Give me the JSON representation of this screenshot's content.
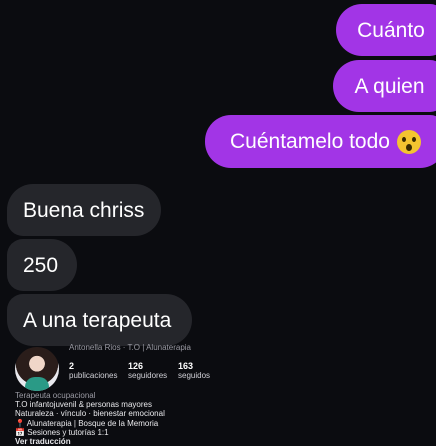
{
  "messages": {
    "sent": [
      {
        "text": "Cuánto"
      },
      {
        "text": "A quien"
      },
      {
        "text": "Cuéntamelo todo",
        "emoji": "face-screaming-in-fear-icon"
      }
    ],
    "received": [
      {
        "text": "Buena chriss"
      },
      {
        "text": "250"
      },
      {
        "text": "A una terapeuta"
      }
    ]
  },
  "profile": {
    "header_partial": "Antonella Rios · T.O | Alunaterapia",
    "stats": [
      {
        "value": "2",
        "label": "publicaciones"
      },
      {
        "value": "126",
        "label": "seguidores"
      },
      {
        "value": "163",
        "label": "seguidos"
      }
    ],
    "bio": {
      "category": "Terapeuta ocupacional",
      "line1": "T.O infantojuvenil & personas mayores",
      "line2": "Naturaleza · vínculo · bienestar emocional",
      "line3": "Alunaterapia | Bosque de la Memoria",
      "line4": "Sesiones y tutorías 1:1",
      "line5": "Ver traducción"
    }
  },
  "colors": {
    "sent_bubble": "#a235e6",
    "received_bubble": "#25262b",
    "background": "#0b0c10"
  }
}
